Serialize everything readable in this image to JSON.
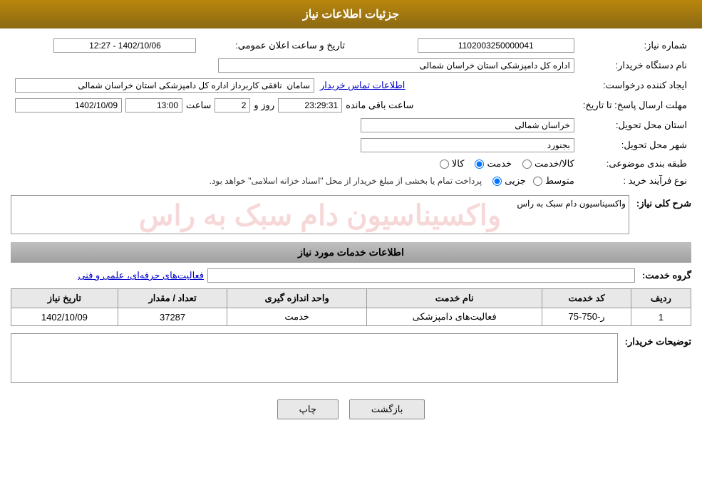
{
  "header": {
    "title": "جزئیات اطلاعات نیاز"
  },
  "fields": {
    "shomara_niaz_label": "شماره نیاز:",
    "shomara_niaz_value": "1102003250000041",
    "name_dastgah_label": "نام دستگاه خریدار:",
    "name_dastgah_value": "اداره کل دامپزشکی استان خراسان شمالی",
    "ijad_label": "ایجاد کننده درخواست:",
    "ijad_value": "سامان  نافقی کاربرداز اداره کل دامپزشکی استان خراسان شمالی",
    "ijad_link": "اطلاعات تماس خریدار",
    "mohlat_label": "مهلت ارسال پاسخ: تا تاریخ:",
    "tarikh_aalam_label": "تاریخ و ساعت اعلان عمومی:",
    "tarikh_aalam_value": "1402/10/06 - 12:27",
    "date_value": "1402/10/09",
    "time_value": "13:00",
    "counter_value": "2",
    "timer_value": "23:29:31",
    "rooz_label": "روز و",
    "saat_label": "ساعت",
    "remaining_label": "ساعت باقی مانده",
    "ostan_label": "استان محل تحویل:",
    "ostan_value": "خراسان شمالی",
    "shahr_label": "شهر محل تحویل:",
    "shahr_value": "بجنورد",
    "tabaqe_label": "طبقه بندی موضوعی:",
    "radio_kala": "کالا",
    "radio_khedmat": "خدمت",
    "radio_kala_khedmat": "کالا/خدمت",
    "nooe_farayand_label": "نوع فرآیند خرید :",
    "radio_jozii": "جزیی",
    "radio_motavasset": "متوسط",
    "nooe_farayand_text": "پرداخت تمام یا بخشی از مبلغ خریدار از محل \"اسناد خزانه اسلامی\" خواهد بود.",
    "sharh_label": "شرح کلی نیاز:",
    "sharh_value": "واکسیناسیون دام سبک به راس",
    "services_section_title": "اطلاعات خدمات مورد نیاز",
    "goroh_label": "گروه خدمت:",
    "goroh_value": "فعالیت‌های حرفه‌ای، علمی و فنی",
    "table_headers": {
      "radif": "ردیف",
      "code_khedmat": "کد خدمت",
      "name_khedmat": "نام خدمت",
      "vahed_andaze": "واحد اندازه گیری",
      "tedad_megdar": "تعداد / مقدار",
      "tarikh_niaz": "تاریخ نیاز"
    },
    "table_rows": [
      {
        "radif": "1",
        "code_khedmat": "ر-750-75",
        "name_khedmat": "فعالیت‌های دامپزشکی",
        "vahed_andaze": "خدمت",
        "tedad_megdar": "37287",
        "tarikh_niaz": "1402/10/09"
      }
    ],
    "description_label": "توضیحات خریدار:",
    "description_value": "",
    "btn_print": "چاپ",
    "btn_back": "بازگشت"
  }
}
